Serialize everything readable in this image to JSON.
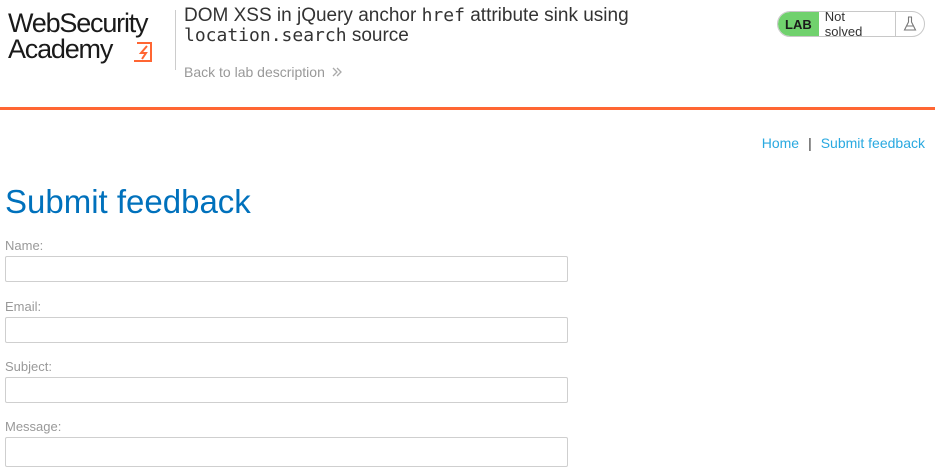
{
  "header": {
    "logo": {
      "line1": "WebSecurity",
      "line2": "Academy",
      "icon": "lightning-icon"
    },
    "lab_title_parts": {
      "p1": "DOM XSS in jQuery anchor ",
      "code1": "href",
      "p2": " attribute sink using",
      "code2": "location.search",
      "p3": " source"
    },
    "back_link": "Back to lab description",
    "lab_badge": "LAB",
    "lab_status": "Not solved"
  },
  "nav": {
    "home": "Home",
    "separator": "|",
    "submit_feedback": "Submit feedback"
  },
  "page_title": "Submit feedback",
  "form": {
    "name_label": "Name:",
    "name_value": "",
    "email_label": "Email:",
    "email_value": "",
    "subject_label": "Subject:",
    "subject_value": "",
    "message_label": "Message:",
    "message_value": ""
  },
  "colors": {
    "accent_orange": "#ff6633",
    "title_blue": "#0071bc",
    "link_blue": "#29a9e0",
    "lab_green": "#70d16d"
  }
}
